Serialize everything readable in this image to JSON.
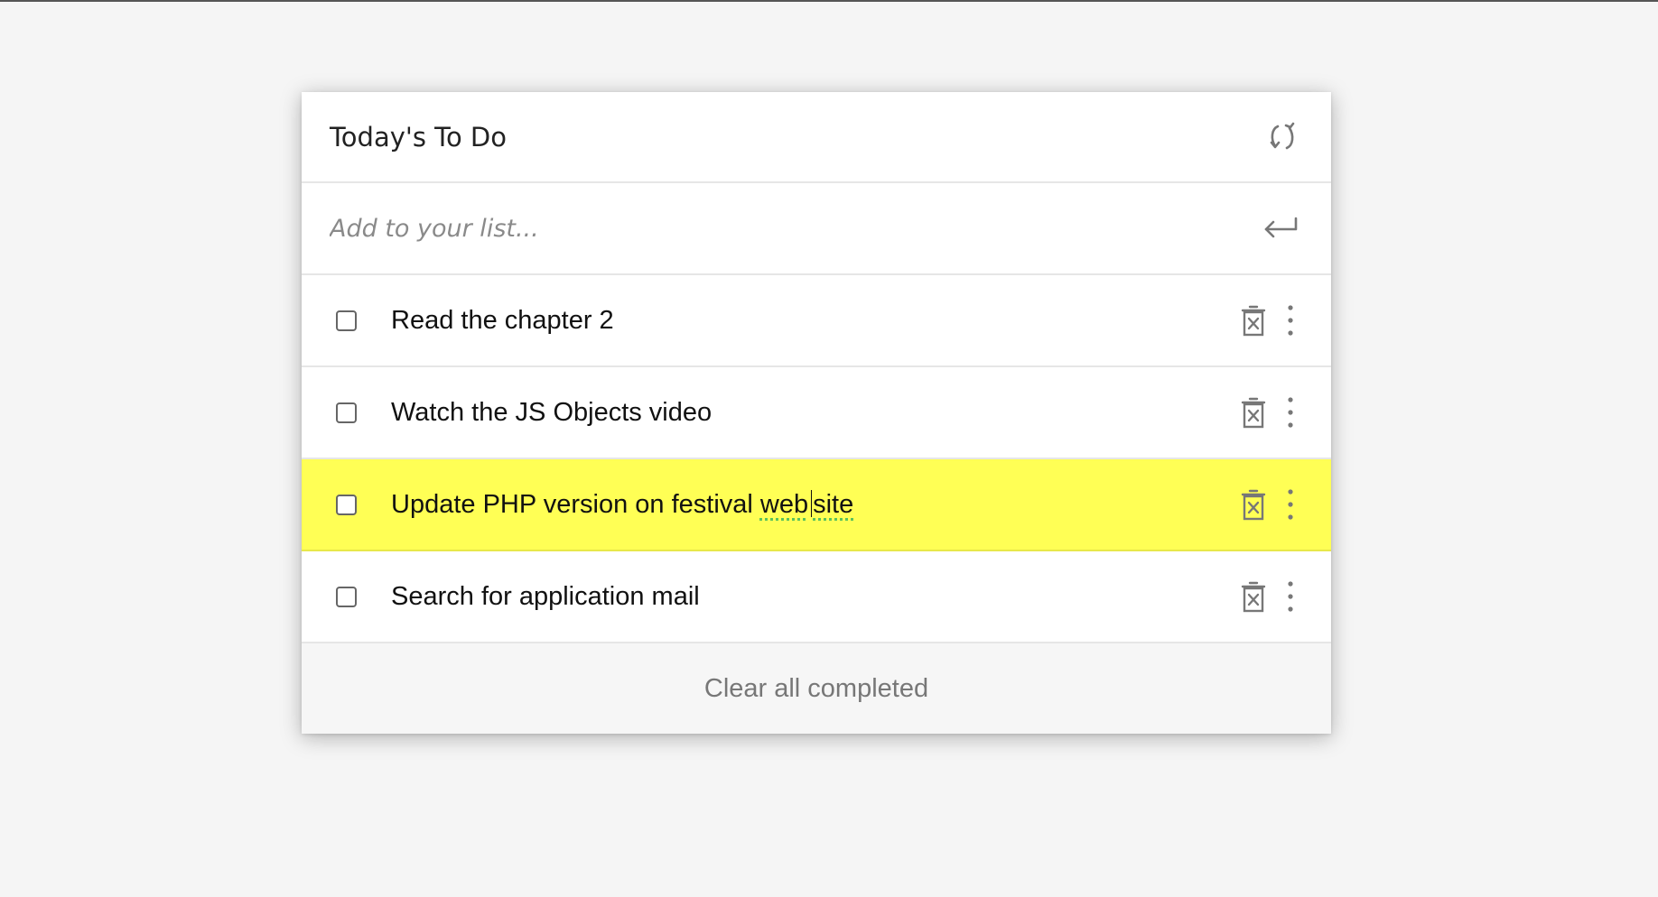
{
  "app": {
    "title": "Today's To Do",
    "refresh_icon": "refresh-icon"
  },
  "add": {
    "placeholder": "Add to your list...",
    "value": "",
    "submit_icon": "enter-icon"
  },
  "items": [
    {
      "text": "Read the chapter 2",
      "checked": false,
      "highlighted": false
    },
    {
      "text": "Watch the JS Objects video",
      "checked": false,
      "highlighted": false
    },
    {
      "text_before": "Update PHP version on festival ",
      "text_web": "web",
      "text_site": "site",
      "checked": false,
      "highlighted": true,
      "editing": true
    },
    {
      "text": "Search for application mail",
      "checked": false,
      "highlighted": false
    }
  ],
  "item_icons": [
    "checkbox",
    "trash-icon",
    "more-vertical-icon"
  ],
  "footer": {
    "clear_label": "Clear all completed"
  },
  "colors": {
    "highlight": "#ffff55",
    "background": "#f5f5f5",
    "icon": "#777777"
  }
}
